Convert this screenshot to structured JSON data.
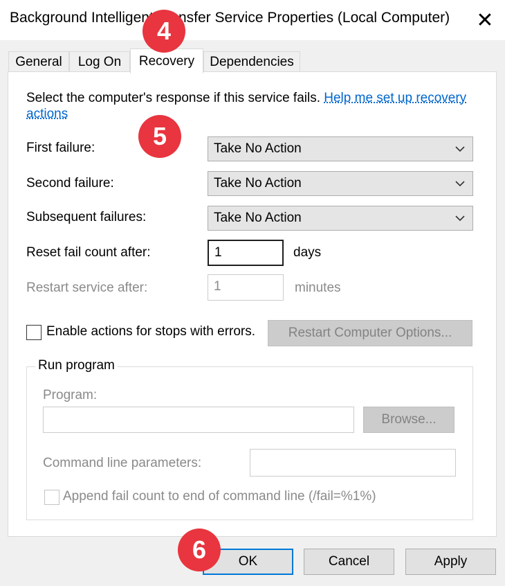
{
  "window": {
    "title": "Background Intelligent Transfer Service Properties (Local Computer)",
    "close_glyph": "✕"
  },
  "tabs": [
    {
      "label": "General"
    },
    {
      "label": "Log On"
    },
    {
      "label": "Recovery",
      "active": true
    },
    {
      "label": "Dependencies"
    }
  ],
  "recovery": {
    "intro_text": "Select the computer's response if this service fails. ",
    "help_link": "Help me set up recovery actions",
    "first_failure_label": "First failure:",
    "first_failure_value": "Take No Action",
    "second_failure_label": "Second failure:",
    "second_failure_value": "Take No Action",
    "subsequent_failures_label": "Subsequent failures:",
    "subsequent_failures_value": "Take No Action",
    "reset_label": "Reset fail count after:",
    "reset_value": "1",
    "reset_unit": "days",
    "restart_label": "Restart service after:",
    "restart_value": "1",
    "restart_unit": "minutes",
    "enable_actions_label": "Enable actions for stops with errors.",
    "restart_computer_options_label": "Restart Computer Options..."
  },
  "run_program": {
    "group_title": "Run program",
    "program_label": "Program:",
    "program_value": "",
    "browse_label": "Browse...",
    "params_label": "Command line parameters:",
    "params_value": "",
    "append_label": "Append fail count to end of command line (/fail=%1%)"
  },
  "footer": {
    "ok_label": "OK",
    "cancel_label": "Cancel",
    "apply_label": "Apply"
  },
  "annotations": [
    {
      "number": "4"
    },
    {
      "number": "5"
    },
    {
      "number": "6"
    }
  ],
  "colors": {
    "link": "#0066cc",
    "badge": "#e8353f",
    "default_button_border": "#0078d7"
  }
}
